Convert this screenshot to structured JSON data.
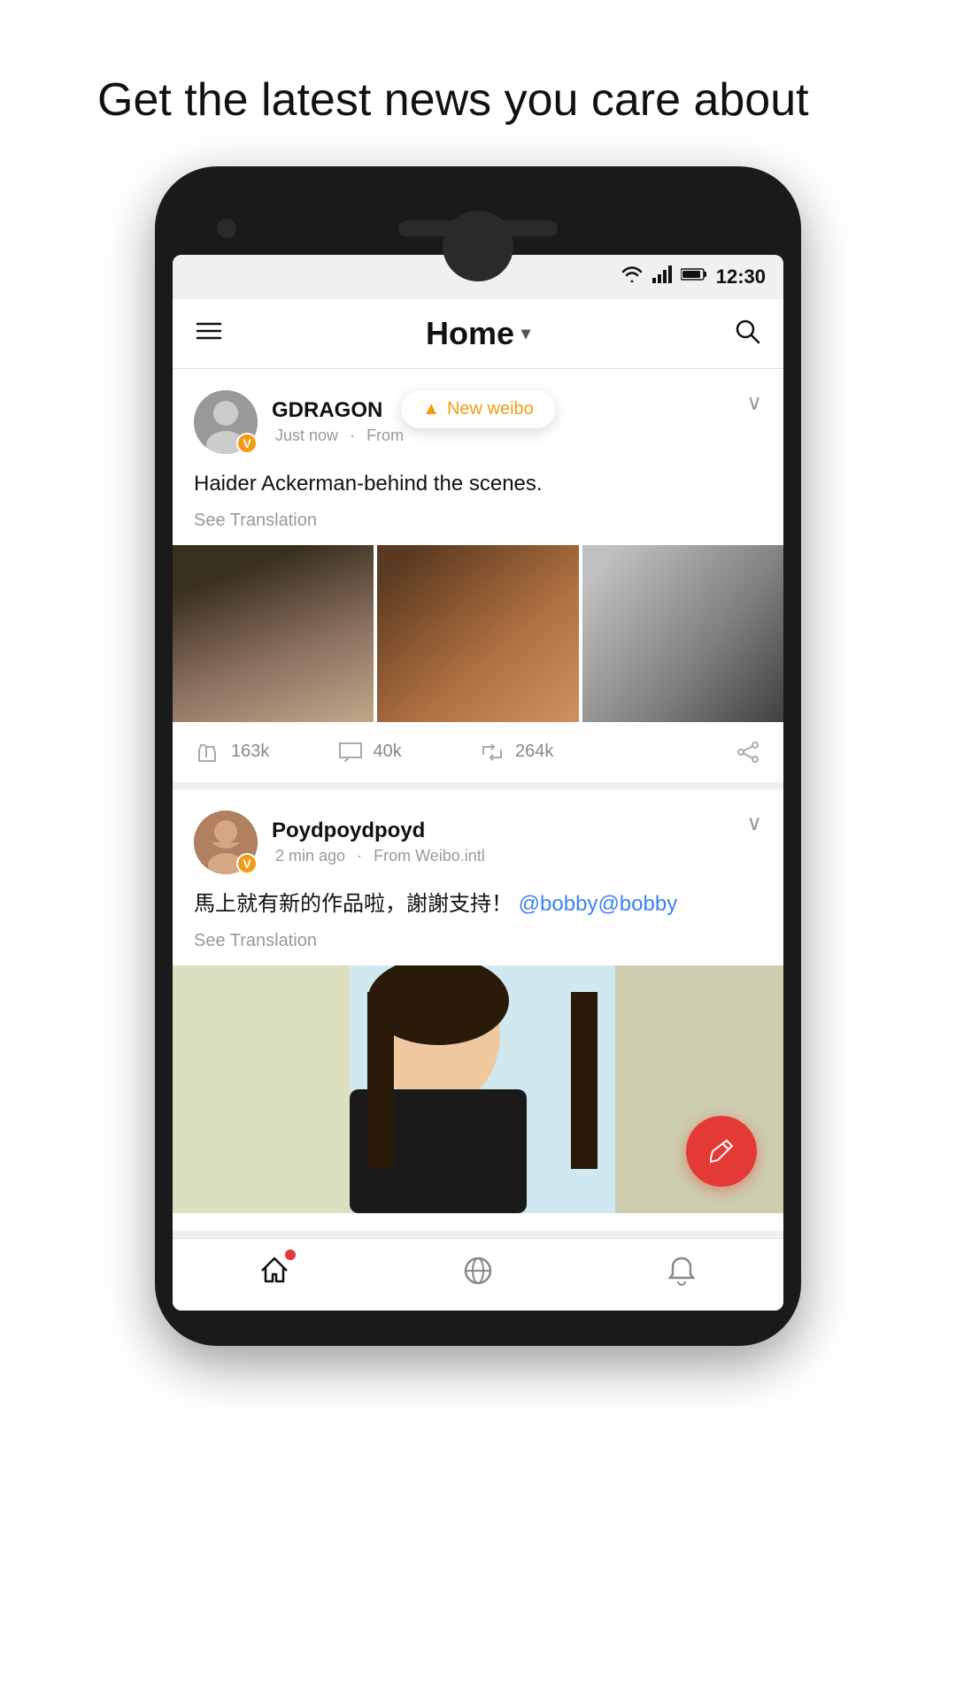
{
  "tagline": "Get the latest news you care about",
  "status": {
    "time": "12:30"
  },
  "header": {
    "title": "Home",
    "hamburger_label": "Menu",
    "search_label": "Search"
  },
  "toast": {
    "label": "New weibo"
  },
  "posts": [
    {
      "id": "post1",
      "username": "GDRAGON",
      "time": "Just now",
      "source": "From",
      "content": "Haider Ackerman-behind the scenes.",
      "see_translation": "See Translation",
      "likes": "163k",
      "comments": "40k",
      "reposts": "264k",
      "verified": "V"
    },
    {
      "id": "post2",
      "username": "Poydpoydpoyd",
      "time": "2 min ago",
      "source": "From Weibo.intl",
      "content": "馬上就有新的作品啦，謝謝支持！",
      "mention": "@bobby",
      "see_translation": "See Translation",
      "verified": "V"
    }
  ],
  "nav": {
    "home_label": "Home",
    "discover_label": "Discover",
    "notifications_label": "Notifications"
  },
  "fab": {
    "label": "Compose"
  }
}
